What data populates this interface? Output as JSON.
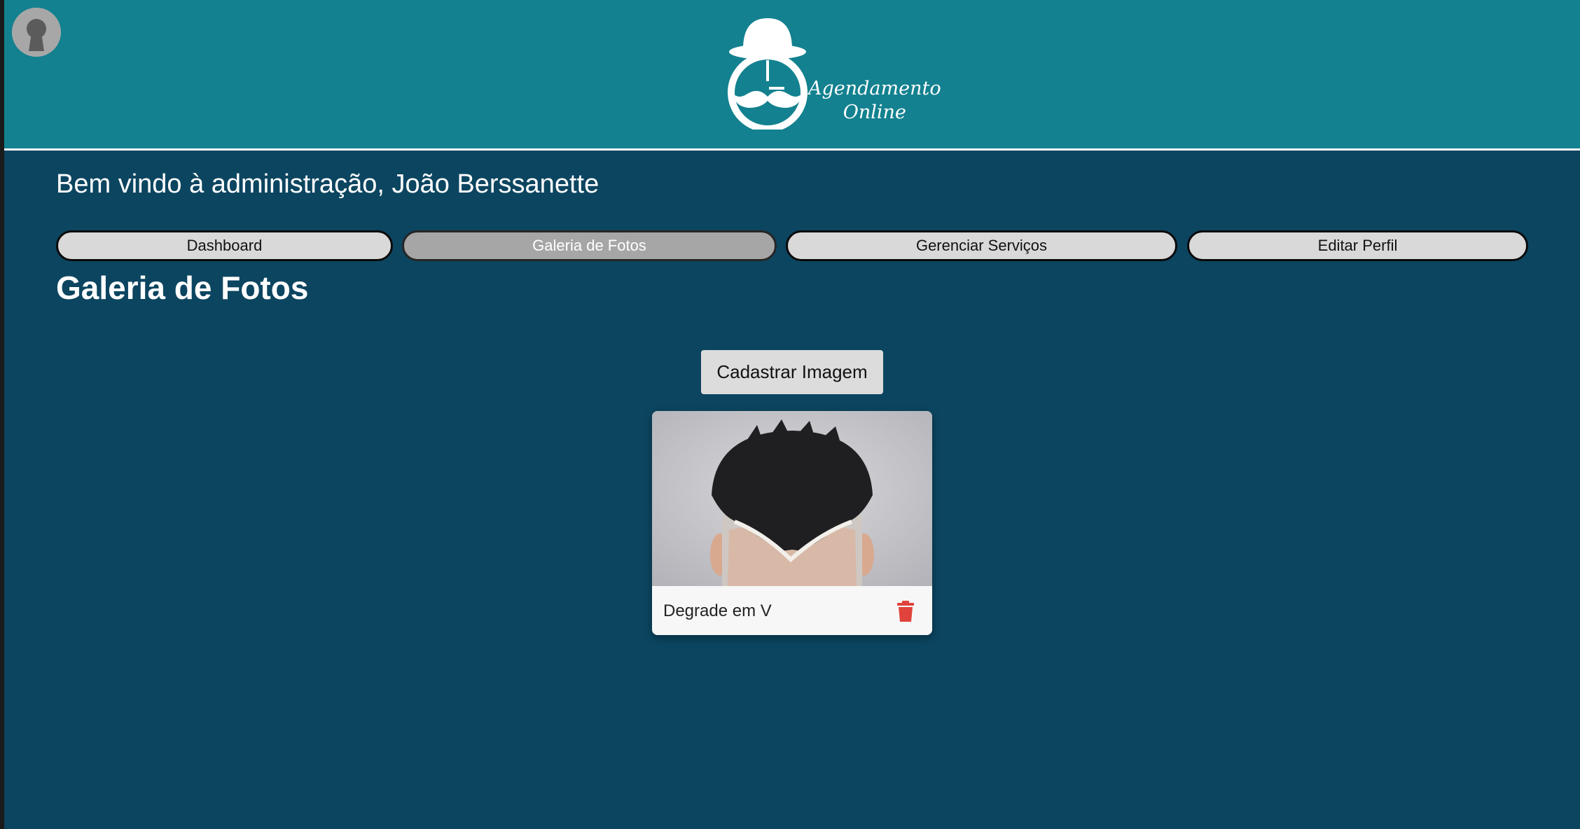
{
  "app": {
    "logo_line1": "Agendamento",
    "logo_line2": "Online"
  },
  "header": {
    "avatar_icon": "user-avatar-icon"
  },
  "welcome_text": "Bem vindo à administração, João Berssanette",
  "tabs": [
    {
      "label": "Dashboard",
      "active": false
    },
    {
      "label": "Galeria de Fotos",
      "active": true
    },
    {
      "label": "Gerenciar Serviços",
      "active": false
    },
    {
      "label": "Editar Perfil",
      "active": false
    }
  ],
  "gallery": {
    "title": "Galeria de Fotos",
    "add_button_label": "Cadastrar Imagem",
    "items": [
      {
        "caption": "Degrade em V",
        "delete_icon": "trash-icon"
      }
    ]
  },
  "colors": {
    "header_bg": "#13818f",
    "page_bg": "#0c4560",
    "tab_bg": "#d9d9d9",
    "tab_active_bg": "#a6a6a6",
    "delete_red": "#e0433b"
  }
}
